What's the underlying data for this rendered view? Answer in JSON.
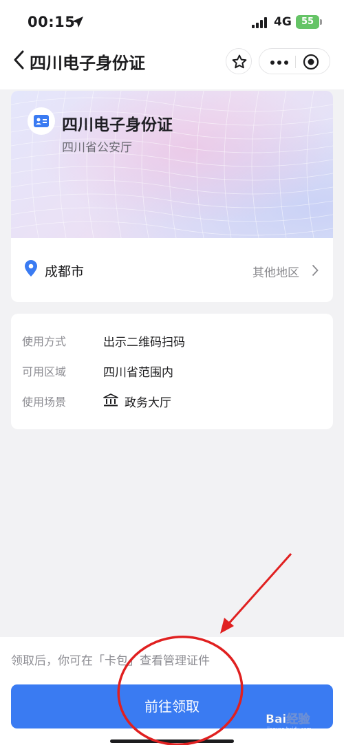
{
  "status_bar": {
    "time": "00:15",
    "network": "4G",
    "battery": "55"
  },
  "nav": {
    "title": "四川电子身份证"
  },
  "card": {
    "title": "四川电子身份证",
    "issuer": "四川省公安厅",
    "city": "成都市",
    "other_region": "其他地区"
  },
  "info": {
    "rows": [
      {
        "label": "使用方式",
        "value": "出示二维码扫码"
      },
      {
        "label": "可用区域",
        "value": "四川省范围内"
      },
      {
        "label": "使用场景",
        "value": "政务大厅"
      }
    ]
  },
  "footer": {
    "hint": "领取后，你可在「卡包」查看管理证件",
    "button_label": "前往领取"
  },
  "watermark": {
    "text": "Bai经验",
    "subtext": "jingyan.baidu.com"
  },
  "colors": {
    "primary": "#3a7bf2",
    "annotation": "#e02020"
  }
}
